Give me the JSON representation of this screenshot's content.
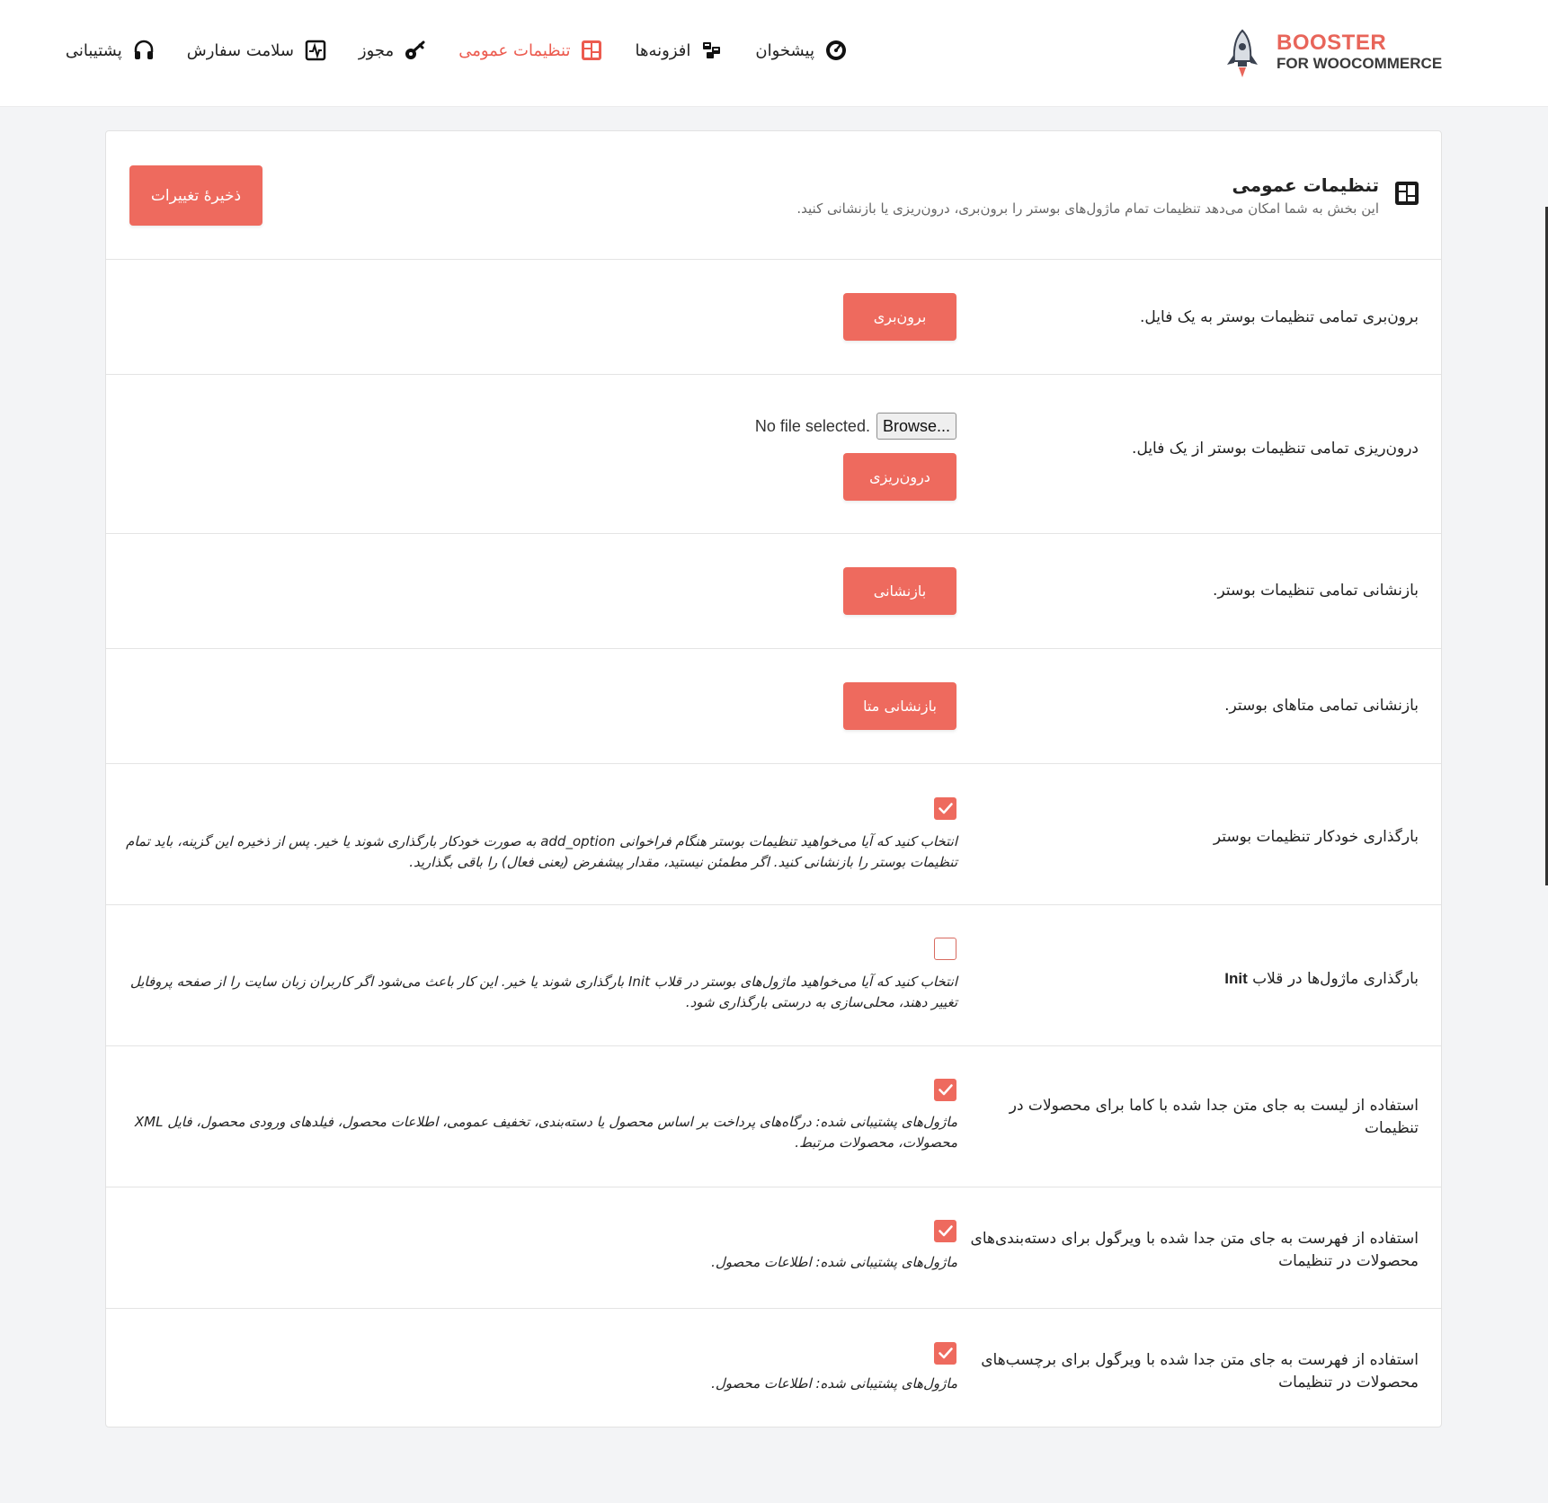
{
  "brand": {
    "top": "BOOSTER",
    "bottom": "FOR WOOCOMMERCE"
  },
  "nav": [
    {
      "label": "پیشخوان",
      "icon": "dashboard-icon",
      "active": false
    },
    {
      "label": "افزونه‌ها",
      "icon": "plugins-icon",
      "active": false
    },
    {
      "label": "تنظیمات عمومی",
      "icon": "settings-grid-icon",
      "active": true
    },
    {
      "label": "مجوز",
      "icon": "key-icon",
      "active": false
    },
    {
      "label": "سلامت سفارش",
      "icon": "health-pulse-icon",
      "active": false
    },
    {
      "label": "پشتیبانی",
      "icon": "headset-icon",
      "active": false
    }
  ],
  "header": {
    "title": "تنظیمات عمومی",
    "description": "این بخش به شما امکان می‌دهد تنظیمات تمام ماژول‌های بوستر را برون‌بری، درون‌ریزی یا بازنشانی کنید.",
    "save_label": "ذخیرهٔ تغییرات"
  },
  "rows": {
    "export": {
      "label": "برون‌بری تمامی تنظیمات بوستر به یک فایل.",
      "button": "برون‌بری"
    },
    "import": {
      "label": "درون‌ریزی تمامی تنظیمات بوستر از یک فایل.",
      "browse": "Browse...",
      "file_status": "No file selected.",
      "button": "درون‌ریزی"
    },
    "reset": {
      "label": "بازنشانی تمامی تنظیمات بوستر.",
      "button": "بازنشانی"
    },
    "reset_meta": {
      "label": "بازنشانی تمامی متاهای بوستر.",
      "button": "بازنشانی متا"
    },
    "autoload": {
      "label": "بارگذاری خودکار تنظیمات بوستر",
      "checked": true,
      "help": "انتخاب کنید که آیا می‌خواهید تنظیمات بوستر هنگام فراخوانی add_option به صورت خودکار بارگذاری شوند یا خیر. پس از ذخیره این گزینه، باید تمام تنظیمات بوستر را بازنشانی کنید. اگر مطمئن نیستید، مقدار پیشفرض (یعنی فعال) را باقی بگذارید."
    },
    "init_hook": {
      "label_prefix": "بارگذاری ماژول‌ها در قلاب",
      "label_code": "Init",
      "checked": false,
      "help": "انتخاب کنید که آیا می‌خواهید ماژول‌های بوستر در قلاب Init بارگذاری شوند یا خیر. این کار باعث می‌شود اگر کاربران زبان سایت را از صفحه پروفایل تغییر دهند، محلی‌سازی به درستی بارگذاری شود."
    },
    "list_products": {
      "label": "استفاده از لیست به جای متن جدا شده با کاما برای محصولات در تنظیمات",
      "checked": true,
      "help": "ماژول‌های پشتیبانی شده: درگاه‌های پرداخت بر اساس محصول یا دسته‌بندی، تخفیف عمومی، اطلاعات محصول، فیلدهای ورودی محصول، فایل XML محصولات، محصولات مرتبط."
    },
    "list_categories": {
      "label": "استفاده از فهرست به جای متن جدا شده با ویرگول برای دسته‌بندی‌های محصولات در تنظیمات",
      "checked": true,
      "help": "ماژول‌های پشتیبانی شده: اطلاعات محصول."
    },
    "list_tags": {
      "label": "استفاده از فهرست به جای متن جدا شده با ویرگول برای برچسب‌های محصولات در تنظیمات",
      "checked": true,
      "help": "ماژول‌های پشتیبانی شده: اطلاعات محصول."
    }
  },
  "colors": {
    "accent": "#ee6a5e",
    "active_nav": "#ec5b4f"
  }
}
